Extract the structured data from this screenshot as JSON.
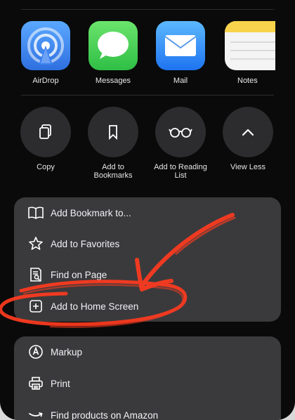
{
  "apps": [
    {
      "id": "airdrop",
      "label": "AirDrop",
      "icon": "airdrop-icon"
    },
    {
      "id": "messages",
      "label": "Messages",
      "icon": "messages-icon"
    },
    {
      "id": "mail",
      "label": "Mail",
      "icon": "mail-icon"
    },
    {
      "id": "notes",
      "label": "Notes",
      "icon": "notes-icon"
    }
  ],
  "actions": [
    {
      "label": "Copy",
      "icon": "copy-icon"
    },
    {
      "label": "Add to\nBookmarks",
      "icon": "bookmark-icon"
    },
    {
      "label": "Add to Reading\nList",
      "icon": "reading-glasses-icon"
    },
    {
      "label": "View Less",
      "icon": "chevron-up-icon"
    }
  ],
  "menu_group_1": [
    {
      "label": "Add Bookmark to...",
      "icon": "book-icon"
    },
    {
      "label": "Add to Favorites",
      "icon": "star-icon"
    },
    {
      "label": "Find on Page",
      "icon": "find-page-icon"
    },
    {
      "label": "Add to Home Screen",
      "icon": "plus-square-icon"
    }
  ],
  "menu_group_2": [
    {
      "label": "Markup",
      "icon": "markup-icon"
    },
    {
      "label": "Print",
      "icon": "printer-icon"
    },
    {
      "label": "Find products on Amazon",
      "icon": "amazon-icon"
    }
  ],
  "colors": {
    "sheet": "#0a0a0a",
    "group": "#3a3a3c",
    "circle": "#2c2c2e",
    "annotation": "#ff3b1f"
  }
}
